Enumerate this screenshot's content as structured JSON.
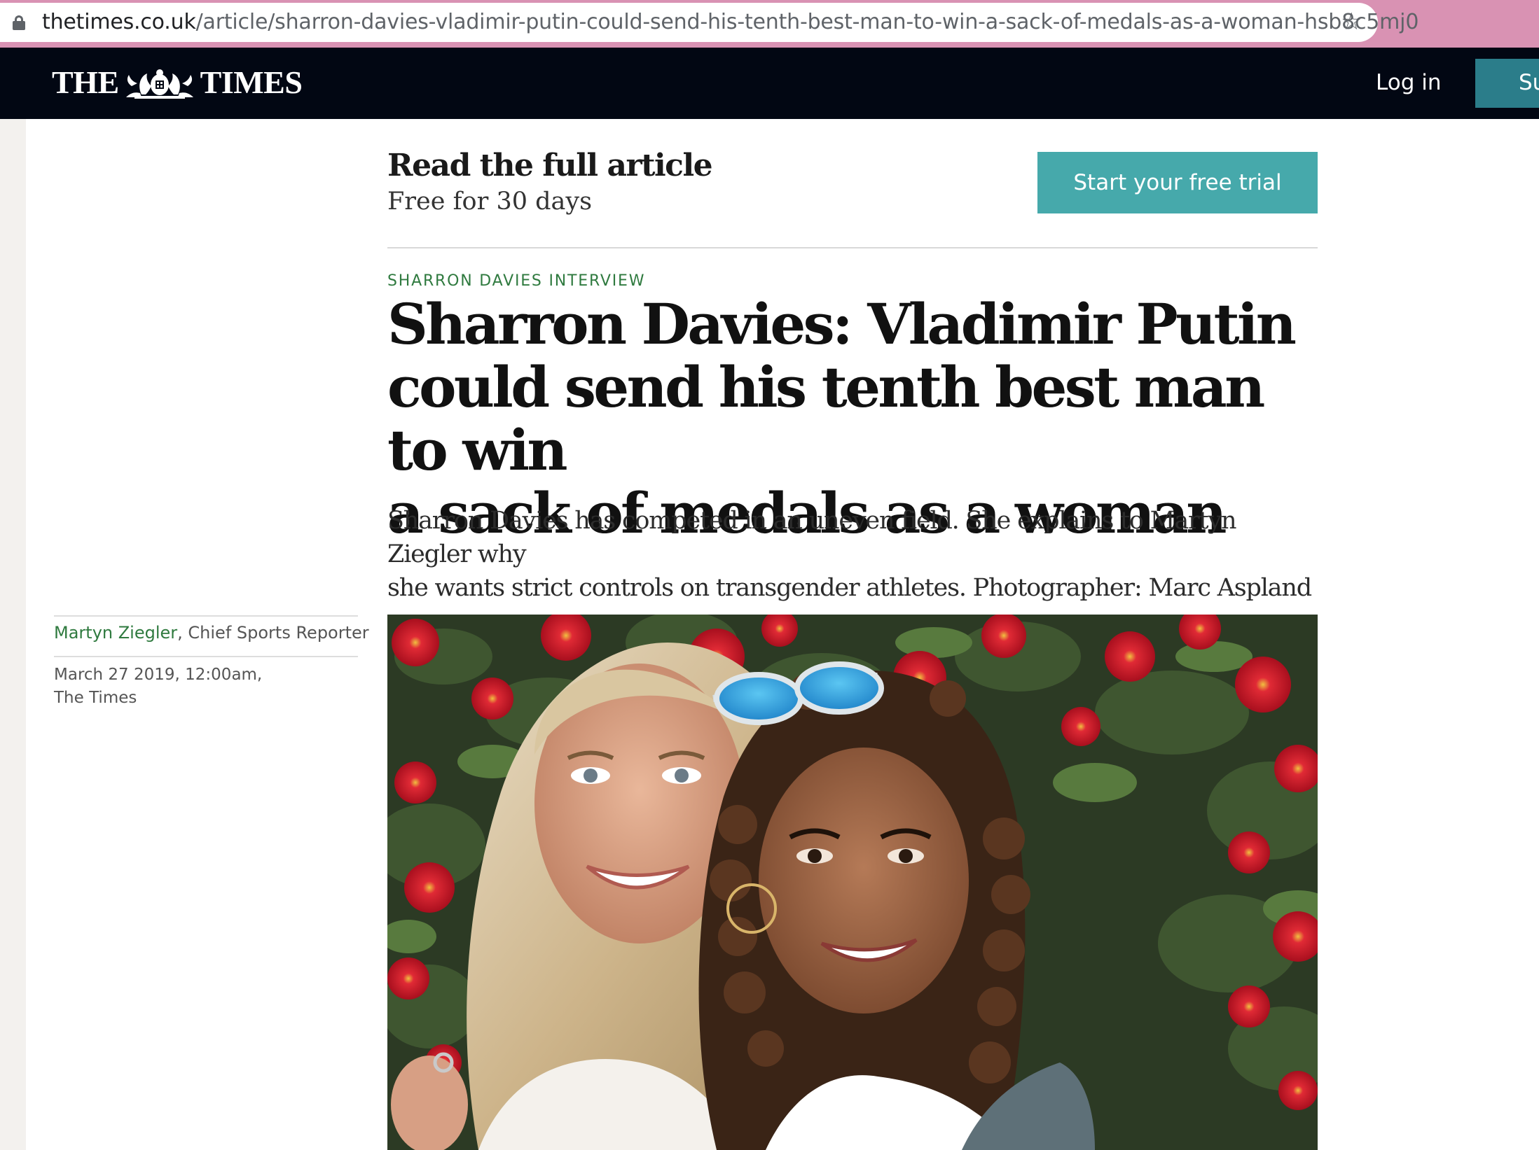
{
  "browser": {
    "url_domain": "thetimes.co.uk",
    "url_path": "/article/sharron-davies-vladimir-putin-could-send-his-tenth-best-man-to-win-a-sack-of-medals-as-a-woman-hsb8c5mj0",
    "icons": [
      "lock-icon",
      "bookmark-star-icon"
    ]
  },
  "header": {
    "logo_left": "THE",
    "logo_right": "TIMES",
    "login_label": "Log in",
    "subscribe_label": "Su"
  },
  "promo": {
    "title": "Read the full article",
    "subtitle": "Free for 30 days",
    "button_label": "Start your free trial"
  },
  "article": {
    "kicker": "SHARRON DAVIES INTERVIEW",
    "headline_lines": [
      "Sharron Davies: Vladimir Putin",
      "could send his tenth best man to win",
      "a sack of medals as a woman"
    ],
    "standfirst_lines": [
      "Sharron Davies has competed in an uneven field. She explains to Martyn Ziegler why",
      "she wants strict controls on transgender athletes. Photographer: Marc Aspland"
    ],
    "author": "Martyn Ziegler",
    "author_role": ", Chief Sports Reporter",
    "date": "March 27 2019, 12:00am,",
    "publication": "The Times"
  },
  "colors": {
    "masthead": "#020713",
    "accent_teal": "#46a9ab",
    "kicker_green": "#2f7a3f",
    "chrome_pink": "#d992b3"
  }
}
